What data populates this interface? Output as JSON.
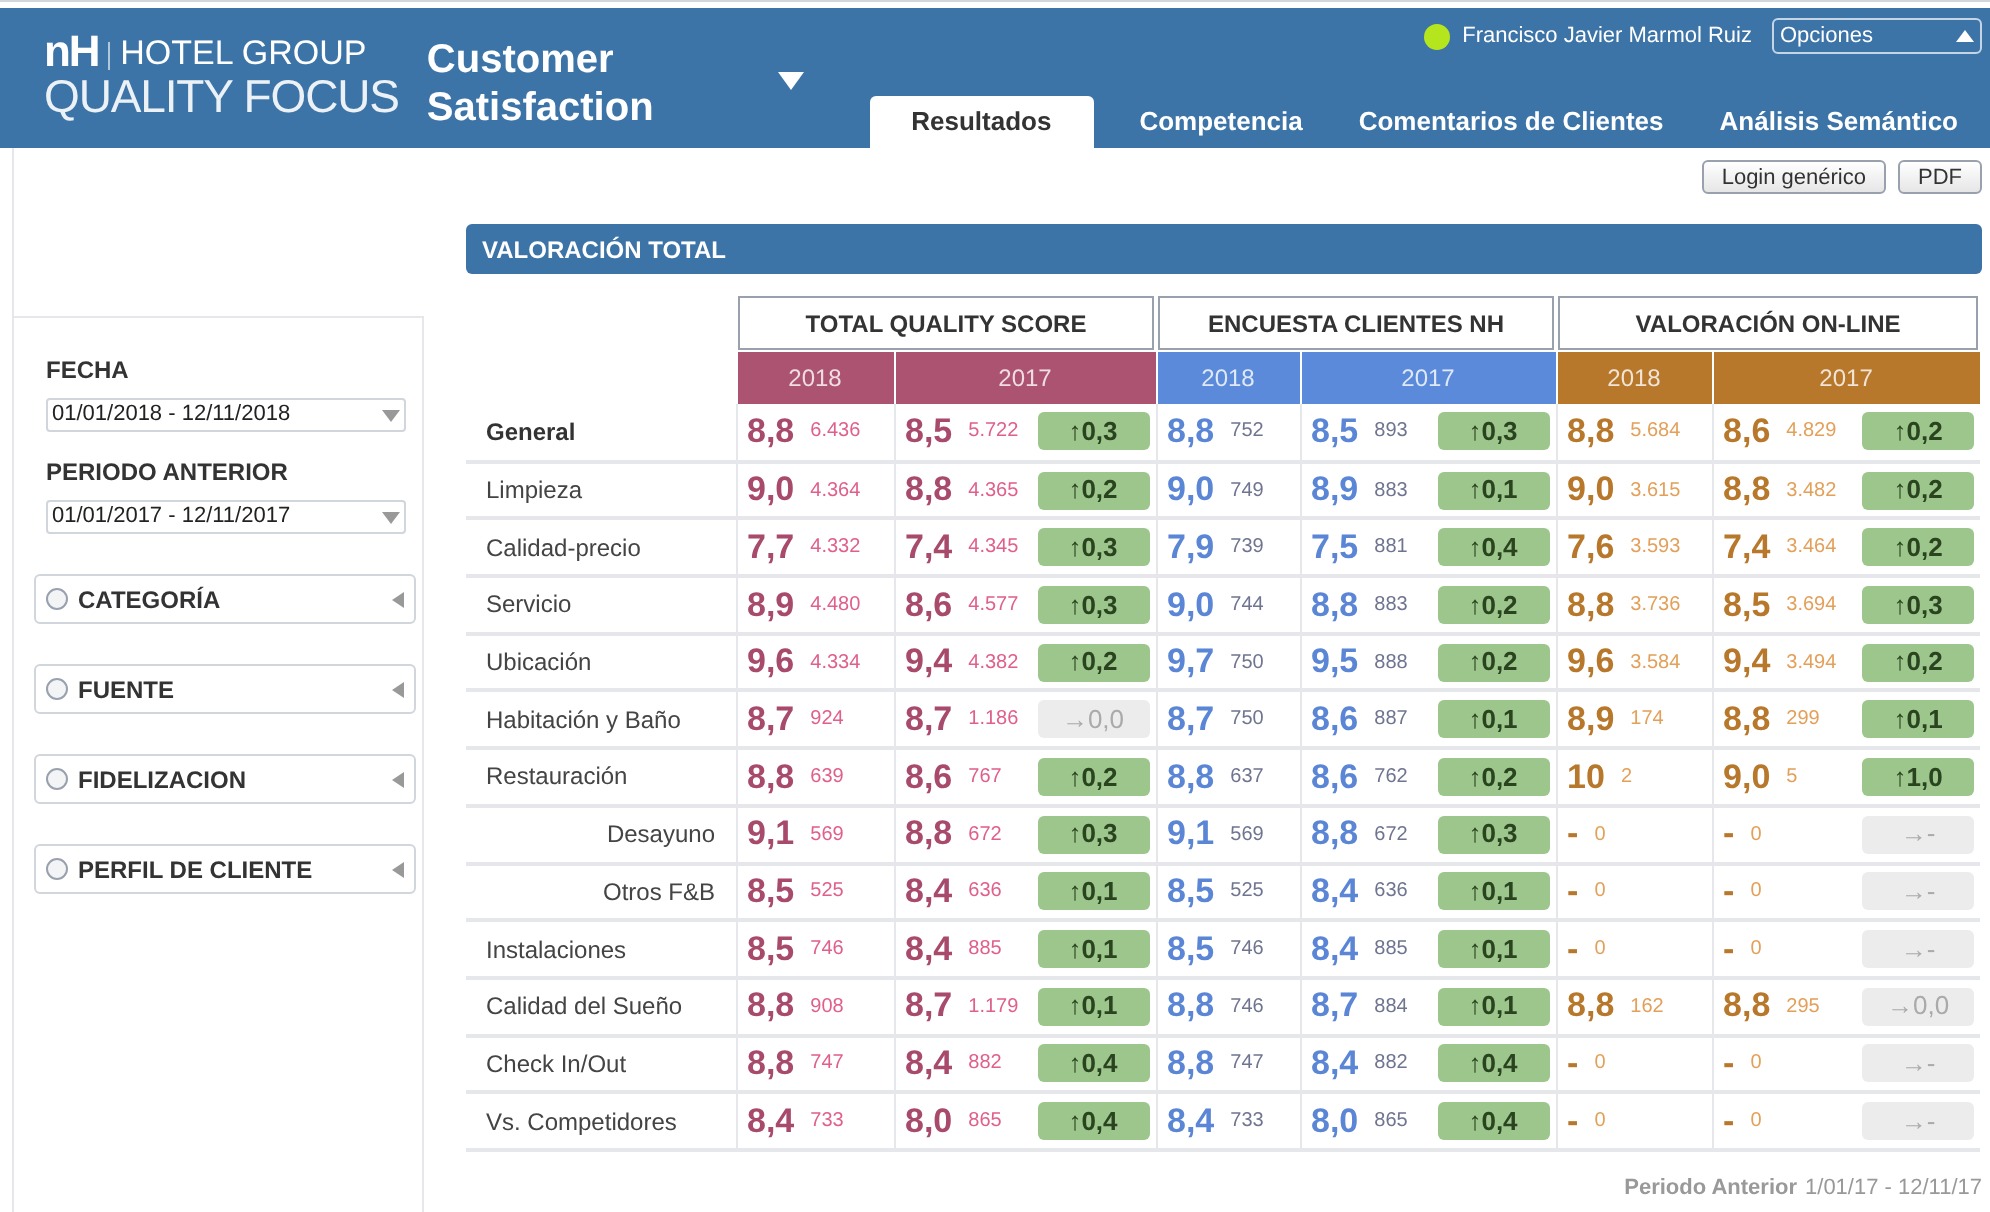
{
  "header": {
    "logo_mark": "nH",
    "logo_group": "HOTEL GROUP",
    "logo_product": "QUALITY FOCUS",
    "title": "Customer Satisfaction",
    "user": "Francisco Javier Marmol Ruiz",
    "options": "Opciones"
  },
  "tabs": [
    {
      "label": "Resultados",
      "selected": true
    },
    {
      "label": "Competencia",
      "selected": false
    },
    {
      "label": "Comentarios de Clientes",
      "selected": false
    },
    {
      "label": "Análisis Semántico",
      "selected": false
    }
  ],
  "actions": [
    "Login genérico",
    "PDF"
  ],
  "sidebar": {
    "filters": [
      {
        "label": "FECHA",
        "value": "01/01/2018 - 12/11/2018"
      },
      {
        "label": "PERIODO ANTERIOR",
        "value": "01/01/2017 - 12/11/2017"
      }
    ],
    "panels": [
      {
        "label": "CATEGORÍA",
        "expanded": false
      },
      {
        "label": "FUENTE",
        "expanded": false
      },
      {
        "label": "FIDELIZACION",
        "expanded": false
      },
      {
        "label": "PERFIL DE CLIENTE",
        "expanded": false
      }
    ]
  },
  "section_title": "VALORACIÓN TOTAL",
  "table": {
    "groups": [
      {
        "title": "TOTAL QUALITY SCORE",
        "color": "#ab5370",
        "years": [
          "2018",
          "2017"
        ]
      },
      {
        "title": "ENCUESTA CLIENTES NH",
        "color": "#5a8ad9",
        "years": [
          "2018",
          "2017"
        ]
      },
      {
        "title": "VALORACIÓN ON-LINE",
        "color": "#b7782b",
        "years": [
          "2018",
          "2017"
        ]
      }
    ],
    "rows": [
      {
        "label": "General",
        "kind": "total",
        "groups": [
          {
            "current": [
              "8,8",
              "6.436"
            ],
            "previous": [
              "8,5",
              "5.722"
            ],
            "change": "↑0,3",
            "improved": true
          },
          {
            "current": [
              "8,8",
              "752"
            ],
            "previous": [
              "8,5",
              "893"
            ],
            "change": "↑0,3",
            "improved": true
          },
          {
            "current": [
              "8,8",
              "5.684"
            ],
            "previous": [
              "8,6",
              "4.829"
            ],
            "change": "↑0,2",
            "improved": true
          }
        ]
      },
      {
        "label": "Limpieza",
        "kind": "item",
        "groups": [
          {
            "current": [
              "9,0",
              "4.364"
            ],
            "previous": [
              "8,8",
              "4.365"
            ],
            "change": "↑0,2",
            "improved": true
          },
          {
            "current": [
              "9,0",
              "749"
            ],
            "previous": [
              "8,9",
              "883"
            ],
            "change": "↑0,1",
            "improved": true
          },
          {
            "current": [
              "9,0",
              "3.615"
            ],
            "previous": [
              "8,8",
              "3.482"
            ],
            "change": "↑0,2",
            "improved": true
          }
        ]
      },
      {
        "label": "Calidad-precio",
        "kind": "item",
        "groups": [
          {
            "current": [
              "7,7",
              "4.332"
            ],
            "previous": [
              "7,4",
              "4.345"
            ],
            "change": "↑0,3",
            "improved": true
          },
          {
            "current": [
              "7,9",
              "739"
            ],
            "previous": [
              "7,5",
              "881"
            ],
            "change": "↑0,4",
            "improved": true
          },
          {
            "current": [
              "7,6",
              "3.593"
            ],
            "previous": [
              "7,4",
              "3.464"
            ],
            "change": "↑0,2",
            "improved": true
          }
        ]
      },
      {
        "label": "Servicio",
        "kind": "item",
        "groups": [
          {
            "current": [
              "8,9",
              "4.480"
            ],
            "previous": [
              "8,6",
              "4.577"
            ],
            "change": "↑0,3",
            "improved": true
          },
          {
            "current": [
              "9,0",
              "744"
            ],
            "previous": [
              "8,8",
              "883"
            ],
            "change": "↑0,2",
            "improved": true
          },
          {
            "current": [
              "8,8",
              "3.736"
            ],
            "previous": [
              "8,5",
              "3.694"
            ],
            "change": "↑0,3",
            "improved": true
          }
        ]
      },
      {
        "label": "Ubicación",
        "kind": "item",
        "groups": [
          {
            "current": [
              "9,6",
              "4.334"
            ],
            "previous": [
              "9,4",
              "4.382"
            ],
            "change": "↑0,2",
            "improved": true
          },
          {
            "current": [
              "9,7",
              "750"
            ],
            "previous": [
              "9,5",
              "888"
            ],
            "change": "↑0,2",
            "improved": true
          },
          {
            "current": [
              "9,6",
              "3.584"
            ],
            "previous": [
              "9,4",
              "3.494"
            ],
            "change": "↑0,2",
            "improved": true
          }
        ]
      },
      {
        "label": "Habitación y Baño",
        "kind": "item",
        "groups": [
          {
            "current": [
              "8,7",
              "924"
            ],
            "previous": [
              "8,7",
              "1.186"
            ],
            "change": "→0,0",
            "improved": false
          },
          {
            "current": [
              "8,7",
              "750"
            ],
            "previous": [
              "8,6",
              "887"
            ],
            "change": "↑0,1",
            "improved": true
          },
          {
            "current": [
              "8,9",
              "174"
            ],
            "previous": [
              "8,8",
              "299"
            ],
            "change": "↑0,1",
            "improved": true
          }
        ]
      },
      {
        "label": "Restauración",
        "kind": "item",
        "groups": [
          {
            "current": [
              "8,8",
              "639"
            ],
            "previous": [
              "8,6",
              "767"
            ],
            "change": "↑0,2",
            "improved": true
          },
          {
            "current": [
              "8,8",
              "637"
            ],
            "previous": [
              "8,6",
              "762"
            ],
            "change": "↑0,2",
            "improved": true
          },
          {
            "current": [
              "10",
              "2"
            ],
            "previous": [
              "9,0",
              "5"
            ],
            "change": "↑1,0",
            "improved": true
          }
        ],
        "children": [
          {
            "label": "Desayuno",
            "kind": "item",
            "groups": [
              {
                "current": [
                  "9,1",
                  "569"
                ],
                "previous": [
                  "8,8",
                  "672"
                ],
                "change": "↑0,3",
                "improved": true
              },
              {
                "current": [
                  "9,1",
                  "569"
                ],
                "previous": [
                  "8,8",
                  "672"
                ],
                "change": "↑0,3",
                "improved": true
              },
              {
                "current": [
                  "-",
                  "0"
                ],
                "previous": [
                  "-",
                  "0"
                ],
                "change": "→-",
                "improved": false
              }
            ]
          },
          {
            "label": "Otros F&B",
            "kind": "item",
            "groups": [
              {
                "current": [
                  "8,5",
                  "525"
                ],
                "previous": [
                  "8,4",
                  "636"
                ],
                "change": "↑0,1",
                "improved": true
              },
              {
                "current": [
                  "8,5",
                  "525"
                ],
                "previous": [
                  "8,4",
                  "636"
                ],
                "change": "↑0,1",
                "improved": true
              },
              {
                "current": [
                  "-",
                  "0"
                ],
                "previous": [
                  "-",
                  "0"
                ],
                "change": "→-",
                "improved": false
              }
            ]
          }
        ]
      },
      {
        "label": "Instalaciones",
        "kind": "item",
        "groups": [
          {
            "current": [
              "8,5",
              "746"
            ],
            "previous": [
              "8,4",
              "885"
            ],
            "change": "↑0,1",
            "improved": true
          },
          {
            "current": [
              "8,5",
              "746"
            ],
            "previous": [
              "8,4",
              "885"
            ],
            "change": "↑0,1",
            "improved": true
          },
          {
            "current": [
              "-",
              "0"
            ],
            "previous": [
              "-",
              "0"
            ],
            "change": "→-",
            "improved": false
          }
        ]
      },
      {
        "label": "Calidad del Sueño",
        "kind": "item",
        "groups": [
          {
            "current": [
              "8,8",
              "908"
            ],
            "previous": [
              "8,7",
              "1.179"
            ],
            "change": "↑0,1",
            "improved": true
          },
          {
            "current": [
              "8,8",
              "746"
            ],
            "previous": [
              "8,7",
              "884"
            ],
            "change": "↑0,1",
            "improved": true
          },
          {
            "current": [
              "8,8",
              "162"
            ],
            "previous": [
              "8,8",
              "295"
            ],
            "change": "→0,0",
            "improved": false
          }
        ]
      },
      {
        "label": "Check In/Out",
        "kind": "item",
        "groups": [
          {
            "current": [
              "8,8",
              "747"
            ],
            "previous": [
              "8,4",
              "882"
            ],
            "change": "↑0,4",
            "improved": true
          },
          {
            "current": [
              "8,8",
              "747"
            ],
            "previous": [
              "8,4",
              "882"
            ],
            "change": "↑0,4",
            "improved": true
          },
          {
            "current": [
              "-",
              "0"
            ],
            "previous": [
              "-",
              "0"
            ],
            "change": "→-",
            "improved": false
          }
        ]
      },
      {
        "label": "Vs. Competidores",
        "kind": "item",
        "groups": [
          {
            "current": [
              "8,4",
              "733"
            ],
            "previous": [
              "8,0",
              "865"
            ],
            "change": "↑0,4",
            "improved": true
          },
          {
            "current": [
              "8,4",
              "733"
            ],
            "previous": [
              "8,0",
              "865"
            ],
            "change": "↑0,4",
            "improved": true
          },
          {
            "current": [
              "-",
              "0"
            ],
            "previous": [
              "-",
              "0"
            ],
            "change": "→-",
            "improved": false
          }
        ]
      }
    ]
  },
  "footer": {
    "label": "Periodo Anterior",
    "dates": "1/01/17 - 12/11/17"
  }
}
